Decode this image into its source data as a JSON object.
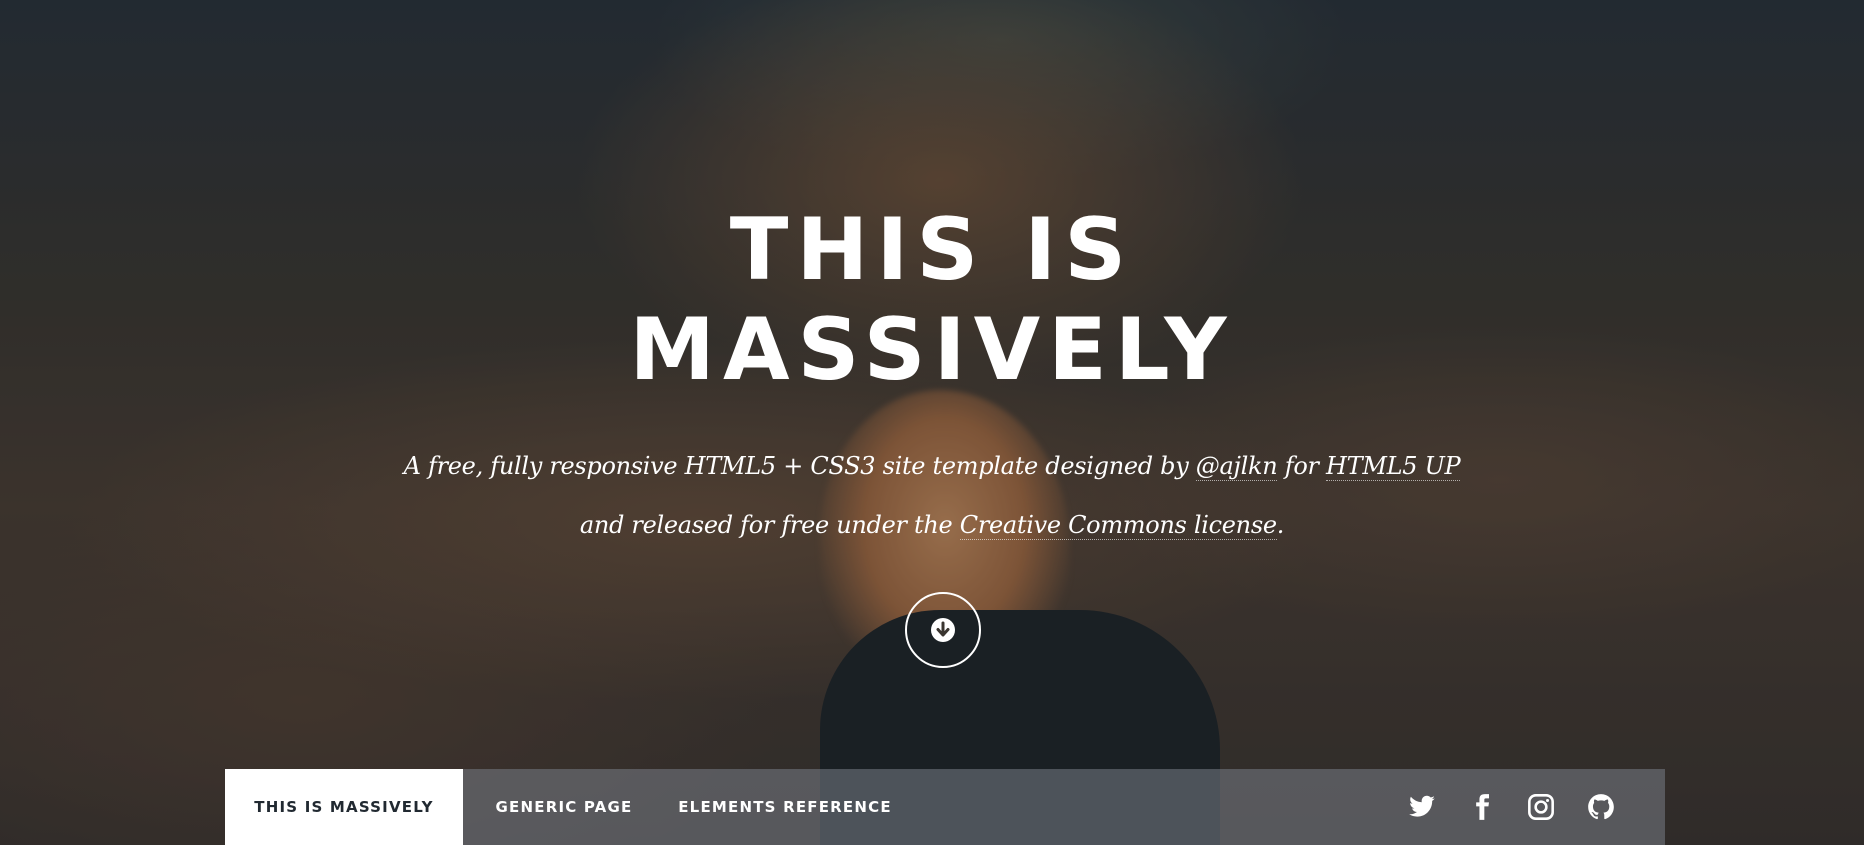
{
  "intro": {
    "title_line1": "THIS IS",
    "title_line2": "MASSIVELY",
    "lead_text_1": "A free, fully responsive HTML5 + CSS3 site template designed by ",
    "lead_link_author": "@ajlkn",
    "lead_text_2": " for ",
    "lead_link_site": "HTML5 UP",
    "lead_text_3": " and released for free under the ",
    "lead_link_license": "Creative Commons license",
    "lead_text_4": ".",
    "scroll_icon": "arrow-down-circle-icon"
  },
  "nav": {
    "links": [
      {
        "label": "THIS IS MASSIVELY",
        "active": true
      },
      {
        "label": "GENERIC PAGE",
        "active": false
      },
      {
        "label": "ELEMENTS REFERENCE",
        "active": false
      }
    ],
    "social_icons": [
      "twitter-icon",
      "facebook-icon",
      "instagram-icon",
      "github-icon"
    ]
  },
  "colors": {
    "text": "#ffffff",
    "active_tab_bg": "#ffffff",
    "active_tab_text": "#212931"
  }
}
